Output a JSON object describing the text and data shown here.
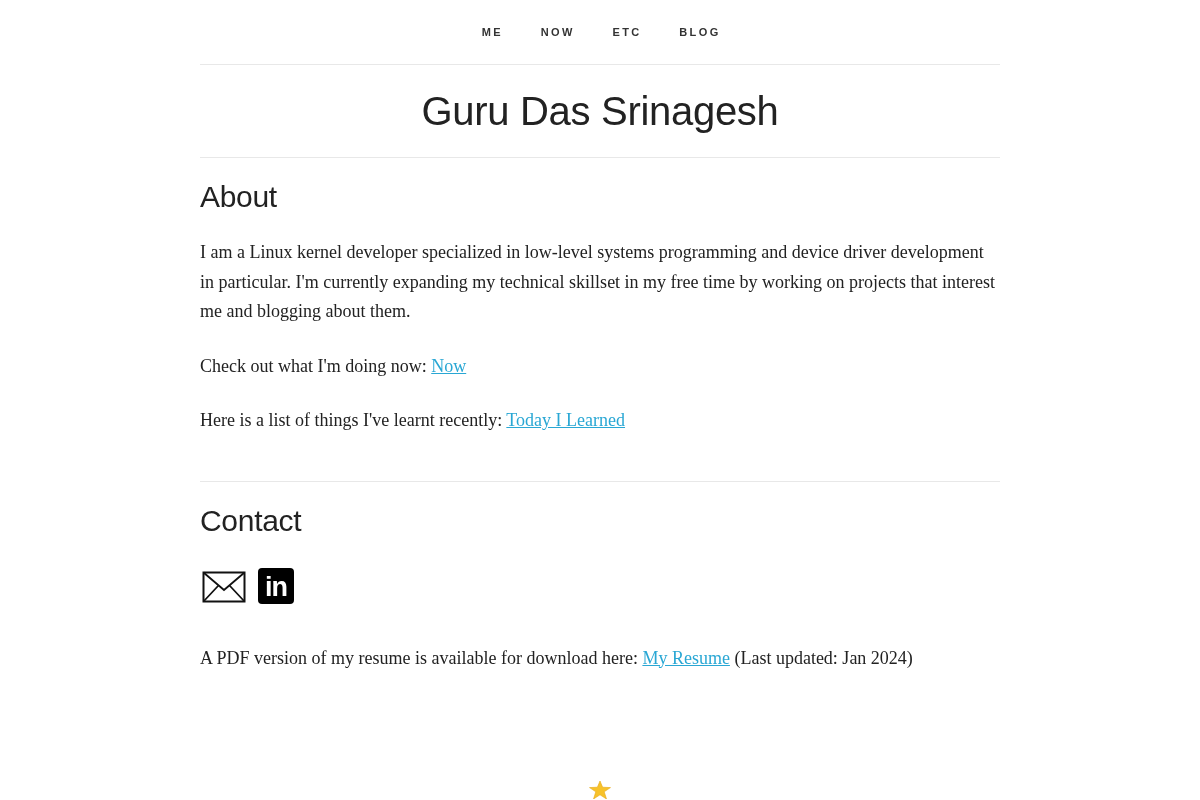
{
  "nav": [
    {
      "label": "ME"
    },
    {
      "label": "NOW"
    },
    {
      "label": "ETC"
    },
    {
      "label": "BLOG"
    }
  ],
  "title": "Guru Das Srinagesh",
  "sections": [
    {
      "heading": "About",
      "paragraphs": [
        {
          "text": "I am a Linux kernel developer specialized in low-level systems programming and device driver development in particular. I'm currently expanding my technical skillset in my free time by working on projects that interest me and blogging about them."
        },
        {
          "text": "Check out what I'm doing now:",
          "link": "Now"
        },
        {
          "text": "Here is a list of things I've learnt recently:",
          "link": "Today I Learned"
        }
      ]
    },
    {
      "heading": "Contact",
      "contact_links": [
        {
          "kind": "envelope"
        },
        {
          "kind": "logo",
          "text": "in"
        }
      ],
      "paragraphs": [
        {
          "text": "A PDF version of my resume is available for download here:",
          "link": "My Resume",
          "after": "(Last updated: Jan 2024)"
        }
      ]
    }
  ]
}
